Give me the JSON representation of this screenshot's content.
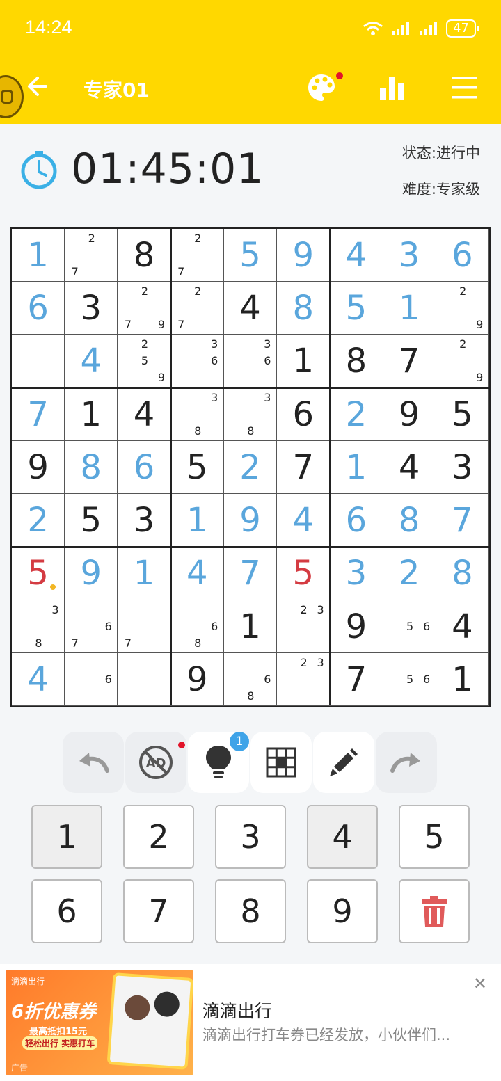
{
  "status_bar": {
    "time": "14:24",
    "battery": "47"
  },
  "nav": {
    "title": "专家01"
  },
  "info": {
    "timer": "01:45:01",
    "state": "状态:进行中",
    "difficulty": "难度:专家级"
  },
  "grid": [
    [
      {
        "v": "1",
        "t": "user"
      },
      {
        "pm": [
          2,
          7
        ]
      },
      {
        "v": "8",
        "t": "given"
      },
      {
        "pm": [
          2,
          7
        ]
      },
      {
        "v": "5",
        "t": "user"
      },
      {
        "v": "9",
        "t": "user"
      },
      {
        "v": "4",
        "t": "user"
      },
      {
        "v": "3",
        "t": "user"
      },
      {
        "v": "6",
        "t": "user"
      }
    ],
    [
      {
        "v": "6",
        "t": "user"
      },
      {
        "v": "3",
        "t": "given"
      },
      {
        "pm": [
          2,
          7,
          9
        ]
      },
      {
        "pm": [
          2,
          7
        ]
      },
      {
        "v": "4",
        "t": "given"
      },
      {
        "v": "8",
        "t": "user"
      },
      {
        "v": "5",
        "t": "user"
      },
      {
        "v": "1",
        "t": "user"
      },
      {
        "pm": [
          2,
          9
        ]
      }
    ],
    [
      {},
      {
        "v": "4",
        "t": "user"
      },
      {
        "pm": [
          2,
          5,
          9
        ]
      },
      {
        "pm": [
          3,
          6
        ]
      },
      {
        "pm": [
          3,
          6
        ]
      },
      {
        "v": "1",
        "t": "given"
      },
      {
        "v": "8",
        "t": "given"
      },
      {
        "v": "7",
        "t": "given"
      },
      {
        "pm": [
          2,
          9
        ]
      }
    ],
    [
      {
        "v": "7",
        "t": "user"
      },
      {
        "v": "1",
        "t": "given"
      },
      {
        "v": "4",
        "t": "given"
      },
      {
        "pm": [
          3,
          8
        ]
      },
      {
        "pm": [
          3,
          8
        ]
      },
      {
        "v": "6",
        "t": "given"
      },
      {
        "v": "2",
        "t": "user"
      },
      {
        "v": "9",
        "t": "given"
      },
      {
        "v": "5",
        "t": "given"
      }
    ],
    [
      {
        "v": "9",
        "t": "given"
      },
      {
        "v": "8",
        "t": "user"
      },
      {
        "v": "6",
        "t": "user"
      },
      {
        "v": "5",
        "t": "given"
      },
      {
        "v": "2",
        "t": "user"
      },
      {
        "v": "7",
        "t": "given"
      },
      {
        "v": "1",
        "t": "user"
      },
      {
        "v": "4",
        "t": "given"
      },
      {
        "v": "3",
        "t": "given"
      }
    ],
    [
      {
        "v": "2",
        "t": "user"
      },
      {
        "v": "5",
        "t": "given"
      },
      {
        "v": "3",
        "t": "given"
      },
      {
        "v": "1",
        "t": "user"
      },
      {
        "v": "9",
        "t": "user"
      },
      {
        "v": "4",
        "t": "user"
      },
      {
        "v": "6",
        "t": "user"
      },
      {
        "v": "8",
        "t": "user"
      },
      {
        "v": "7",
        "t": "user"
      }
    ],
    [
      {
        "v": "5",
        "t": "error",
        "dot": true
      },
      {
        "v": "9",
        "t": "user"
      },
      {
        "v": "1",
        "t": "user"
      },
      {
        "v": "4",
        "t": "user"
      },
      {
        "v": "7",
        "t": "user"
      },
      {
        "v": "5",
        "t": "error"
      },
      {
        "v": "3",
        "t": "user"
      },
      {
        "v": "2",
        "t": "user"
      },
      {
        "v": "8",
        "t": "user"
      }
    ],
    [
      {
        "pm": [
          3,
          8
        ]
      },
      {
        "pm": [
          6,
          7
        ]
      },
      {
        "pm": [
          7
        ]
      },
      {
        "pm": [
          6,
          8
        ]
      },
      {
        "v": "1",
        "t": "given"
      },
      {
        "pm": [
          2,
          3
        ]
      },
      {
        "v": "9",
        "t": "given"
      },
      {
        "pm": [
          5,
          6
        ]
      },
      {
        "v": "4",
        "t": "given"
      }
    ],
    [
      {
        "v": "4",
        "t": "user"
      },
      {
        "pm": [
          6
        ]
      },
      {},
      {
        "v": "9",
        "t": "given"
      },
      {
        "pm": [
          6,
          8
        ]
      },
      {
        "pm": [
          2,
          3
        ]
      },
      {
        "v": "7",
        "t": "given"
      },
      {
        "pm": [
          5,
          6
        ]
      },
      {
        "v": "1",
        "t": "given"
      }
    ]
  ],
  "tools": {
    "hint_count": "1"
  },
  "keypad": {
    "keys": [
      "1",
      "2",
      "3",
      "4",
      "5",
      "6",
      "7",
      "8",
      "9"
    ]
  },
  "ad": {
    "brand": "滴滴出行",
    "promo": "6折优惠券",
    "promo_sub1": "最高抵扣15元",
    "promo_sub2": "轻松出行 实惠打车",
    "label": "广告",
    "title": "滴滴出行",
    "desc": "滴滴出行打车券已经发放，小伙伴们..."
  },
  "colors": {
    "header": "#FFD800",
    "user_digit": "#5aa6dc",
    "error_digit": "#d43b42",
    "accent": "#3ea3e8"
  }
}
